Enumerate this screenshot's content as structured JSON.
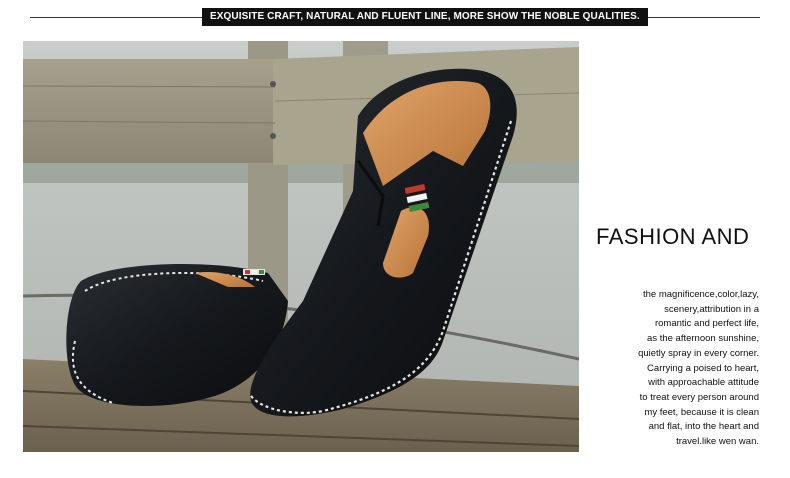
{
  "banner": {
    "text": "EXQUISITE CRAFT, NATURAL AND FLUENT LINE, MORE SHOW THE NOBLE QUALITIES."
  },
  "photo": {
    "subject": "black leather loafers",
    "colors": {
      "leather": "#16191d",
      "stitch": "#e8e6e0",
      "lining": "#c9874a",
      "wood": "#8f8a7c"
    }
  },
  "heading": {
    "text": "FASHION AND"
  },
  "description": {
    "lines": [
      "the magnificence,color,lazy,",
      "scenery,attribution in a",
      "romantic and perfect life,",
      "as the afternoon sunshine,",
      "quietly spray in every corner.",
      "Carrying a poised to heart,",
      "with approachable attitude",
      "to treat every person around",
      "my feet, because it is clean",
      "and flat, into the heart and",
      "travel.like wen wan."
    ]
  }
}
